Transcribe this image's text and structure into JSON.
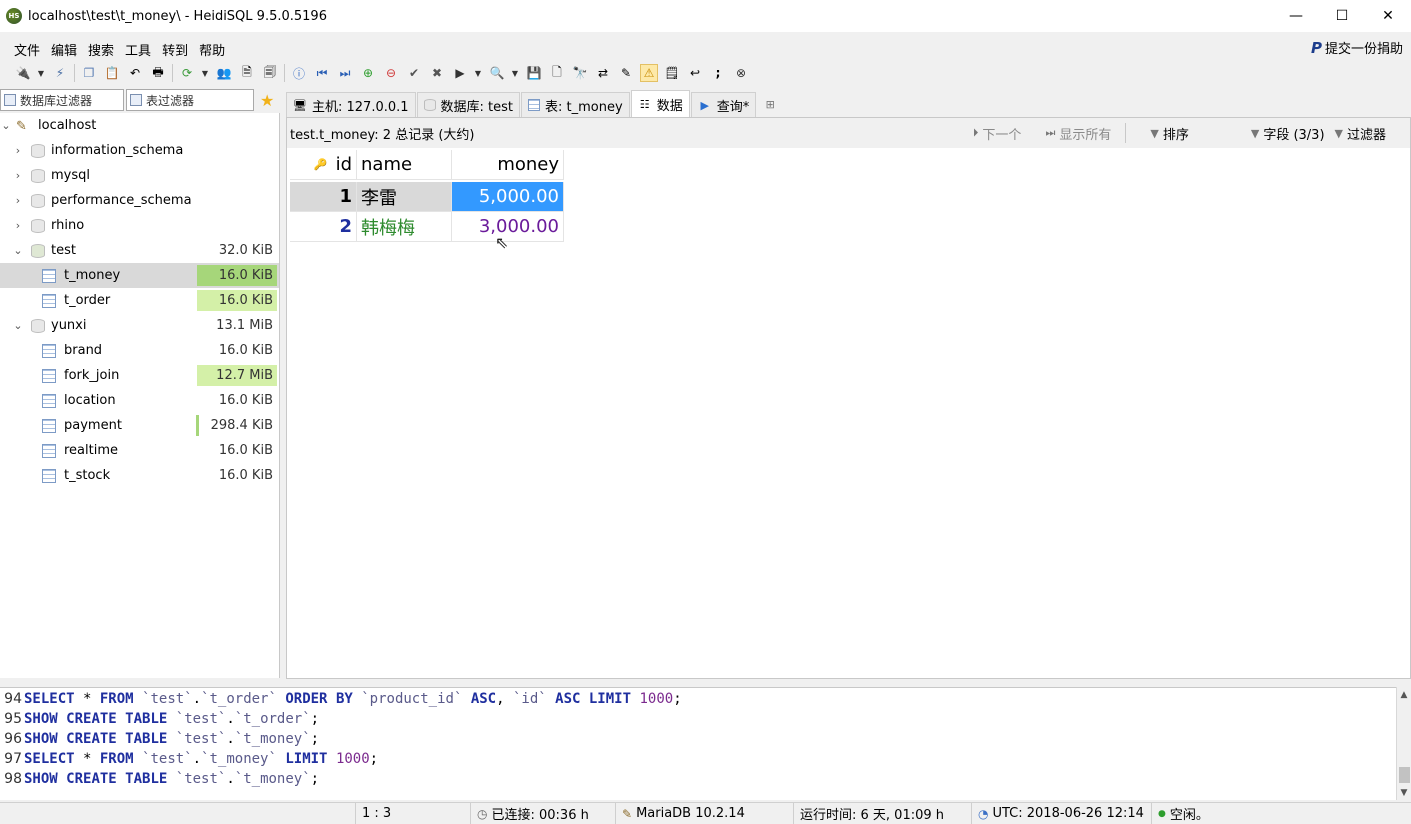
{
  "window": {
    "title": "localhost\\test\\t_money\\ - HeidiSQL 9.5.0.5196",
    "app_icon_text": "HS",
    "controls": [
      "—",
      "☐",
      "✕"
    ]
  },
  "menu": [
    "文件",
    "编辑",
    "搜索",
    "工具",
    "转到",
    "帮助"
  ],
  "donate_label": "提交一份捐助",
  "filters": {
    "db_filter": "数据库过滤器",
    "table_filter": "表过滤器"
  },
  "tree": {
    "root": "localhost",
    "databases": [
      {
        "name": "information_schema",
        "size": ""
      },
      {
        "name": "mysql",
        "size": ""
      },
      {
        "name": "performance_schema",
        "size": ""
      },
      {
        "name": "rhino",
        "size": ""
      },
      {
        "name": "test",
        "size": "32.0 KiB"
      },
      {
        "name": "yunxi",
        "size": "13.1 MiB"
      }
    ],
    "test_tables": [
      {
        "name": "t_money",
        "size": "16.0 KiB",
        "fill": 1.0
      },
      {
        "name": "t_order",
        "size": "16.0 KiB",
        "fill": 1.0
      }
    ],
    "yunxi_tables": [
      {
        "name": "brand",
        "size": "16.0 KiB",
        "fill": 0.0
      },
      {
        "name": "fork_join",
        "size": "12.7 MiB",
        "fill": 1.0
      },
      {
        "name": "location",
        "size": "16.0 KiB",
        "fill": 0.0
      },
      {
        "name": "payment",
        "size": "298.4 KiB",
        "fill": 0.03
      },
      {
        "name": "realtime",
        "size": "16.0 KiB",
        "fill": 0.0
      },
      {
        "name": "t_stock",
        "size": "16.0 KiB",
        "fill": 0.0
      }
    ]
  },
  "tabs": [
    {
      "label": "主机: 127.0.0.1",
      "icon": "host-icon"
    },
    {
      "label": "数据库: test",
      "icon": "database-icon"
    },
    {
      "label": "表: t_money",
      "icon": "table-icon"
    },
    {
      "label": "数据",
      "icon": "data-icon"
    },
    {
      "label": "查询*",
      "icon": "play-icon"
    }
  ],
  "data_view": {
    "summary": "test.t_money: 2 总记录 (大约)",
    "next": "下一个",
    "show_all": "显示所有",
    "sort": "排序",
    "fields": "字段 (3/3)",
    "filter": "过滤器",
    "columns": [
      "id",
      "name",
      "money"
    ],
    "rows": [
      {
        "id": "1",
        "name": "李雷",
        "money": "5,000.00"
      },
      {
        "id": "2",
        "name": "韩梅梅",
        "money": "3,000.00"
      }
    ]
  },
  "sql_log": [
    {
      "n": "94",
      "text": "SELECT * FROM `test`.`t_order` ORDER BY `product_id` ASC, `id` ASC LIMIT 1000;"
    },
    {
      "n": "95",
      "text": "SHOW CREATE TABLE `test`.`t_order`;"
    },
    {
      "n": "96",
      "text": "SHOW CREATE TABLE `test`.`t_money`;"
    },
    {
      "n": "97",
      "text": "SELECT * FROM `test`.`t_money` LIMIT 1000;"
    },
    {
      "n": "98",
      "text": "SHOW CREATE TABLE `test`.`t_money`;"
    }
  ],
  "status": {
    "cursor_pos": "1 : 3",
    "connected": "已连接: 00:36 h",
    "server": "MariaDB 10.2.14",
    "uptime": "运行时间: 6 天, 01:09 h",
    "utc": "UTC: 2018-06-26 12:14",
    "state": "空闲。"
  },
  "colors": {
    "selection_blue": "#3399ff",
    "size_bar_green": "#d4f0a8",
    "name_green": "#2e8b2e",
    "money_purple": "#6a1b9a",
    "keyword_blue": "#1f2f9f"
  }
}
